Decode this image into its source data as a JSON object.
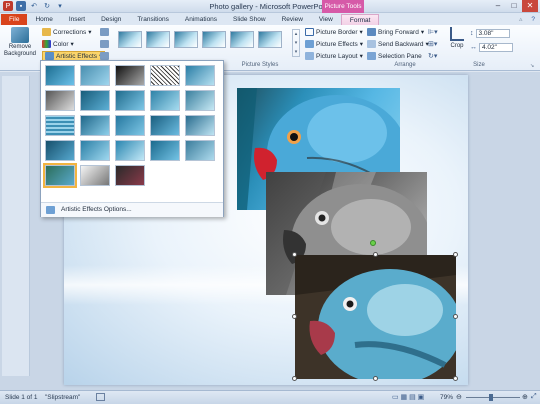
{
  "window": {
    "title": "Photo gallery - Microsoft PowerPoint",
    "contextual_tab": "Picture Tools"
  },
  "tabs": [
    "File",
    "Home",
    "Insert",
    "Design",
    "Transitions",
    "Animations",
    "Slide Show",
    "Review",
    "View",
    "Format"
  ],
  "ribbon": {
    "remove_background": "Remove Background",
    "corrections": "Corrections",
    "color": "Color",
    "artistic_effects": "Artistic Effects",
    "picture_styles_label": "Picture Styles",
    "picture_border": "Picture Border",
    "picture_effects": "Picture Effects",
    "picture_layout": "Picture Layout",
    "bring_forward": "Bring Forward",
    "send_backward": "Send Backward",
    "selection_pane": "Selection Pane",
    "arrange_label": "Arrange",
    "crop": "Crop",
    "height": "3.08\"",
    "width": "4.02\"",
    "size_label": "Size"
  },
  "gallery": {
    "footer": "Artistic Effects Options..."
  },
  "status": {
    "slide": "Slide 1 of 1",
    "theme": "\"Slipstream\"",
    "zoom": "79%"
  },
  "colors": {
    "file_tab": "#d9441c",
    "picture_tools": "#d65aa8",
    "parrot_blue": "#4aa9d8",
    "beak_red": "#d0222e"
  }
}
